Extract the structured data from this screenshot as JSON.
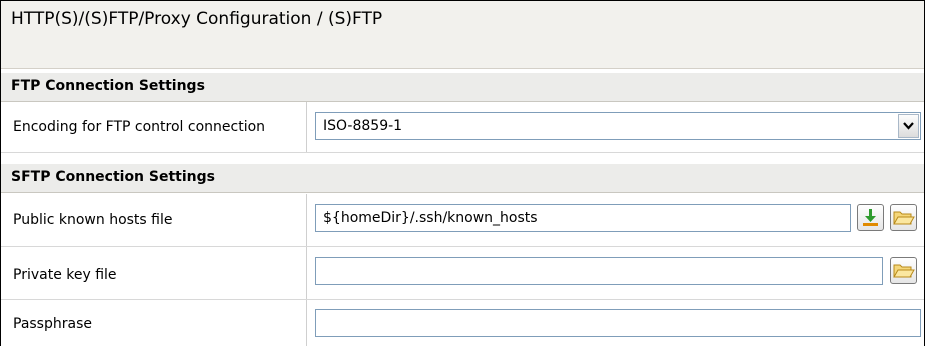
{
  "window": {
    "title": "HTTP(S)/(S)FTP/Proxy Configuration / (S)FTP"
  },
  "ftp_section": {
    "heading": "FTP Connection Settings",
    "encoding_label": "Encoding for FTP control connection",
    "encoding_value": "ISO-8859-1"
  },
  "sftp_section": {
    "heading": "SFTP Connection Settings",
    "known_hosts_label": "Public known hosts file",
    "known_hosts_value": "${homeDir}/.ssh/known_hosts",
    "private_key_label": "Private key file",
    "private_key_value": "",
    "passphrase_label": "Passphrase",
    "passphrase_value": ""
  },
  "icons": {
    "combo": "chevron-down-icon",
    "download": "download-icon",
    "folder": "folder-open-icon"
  }
}
